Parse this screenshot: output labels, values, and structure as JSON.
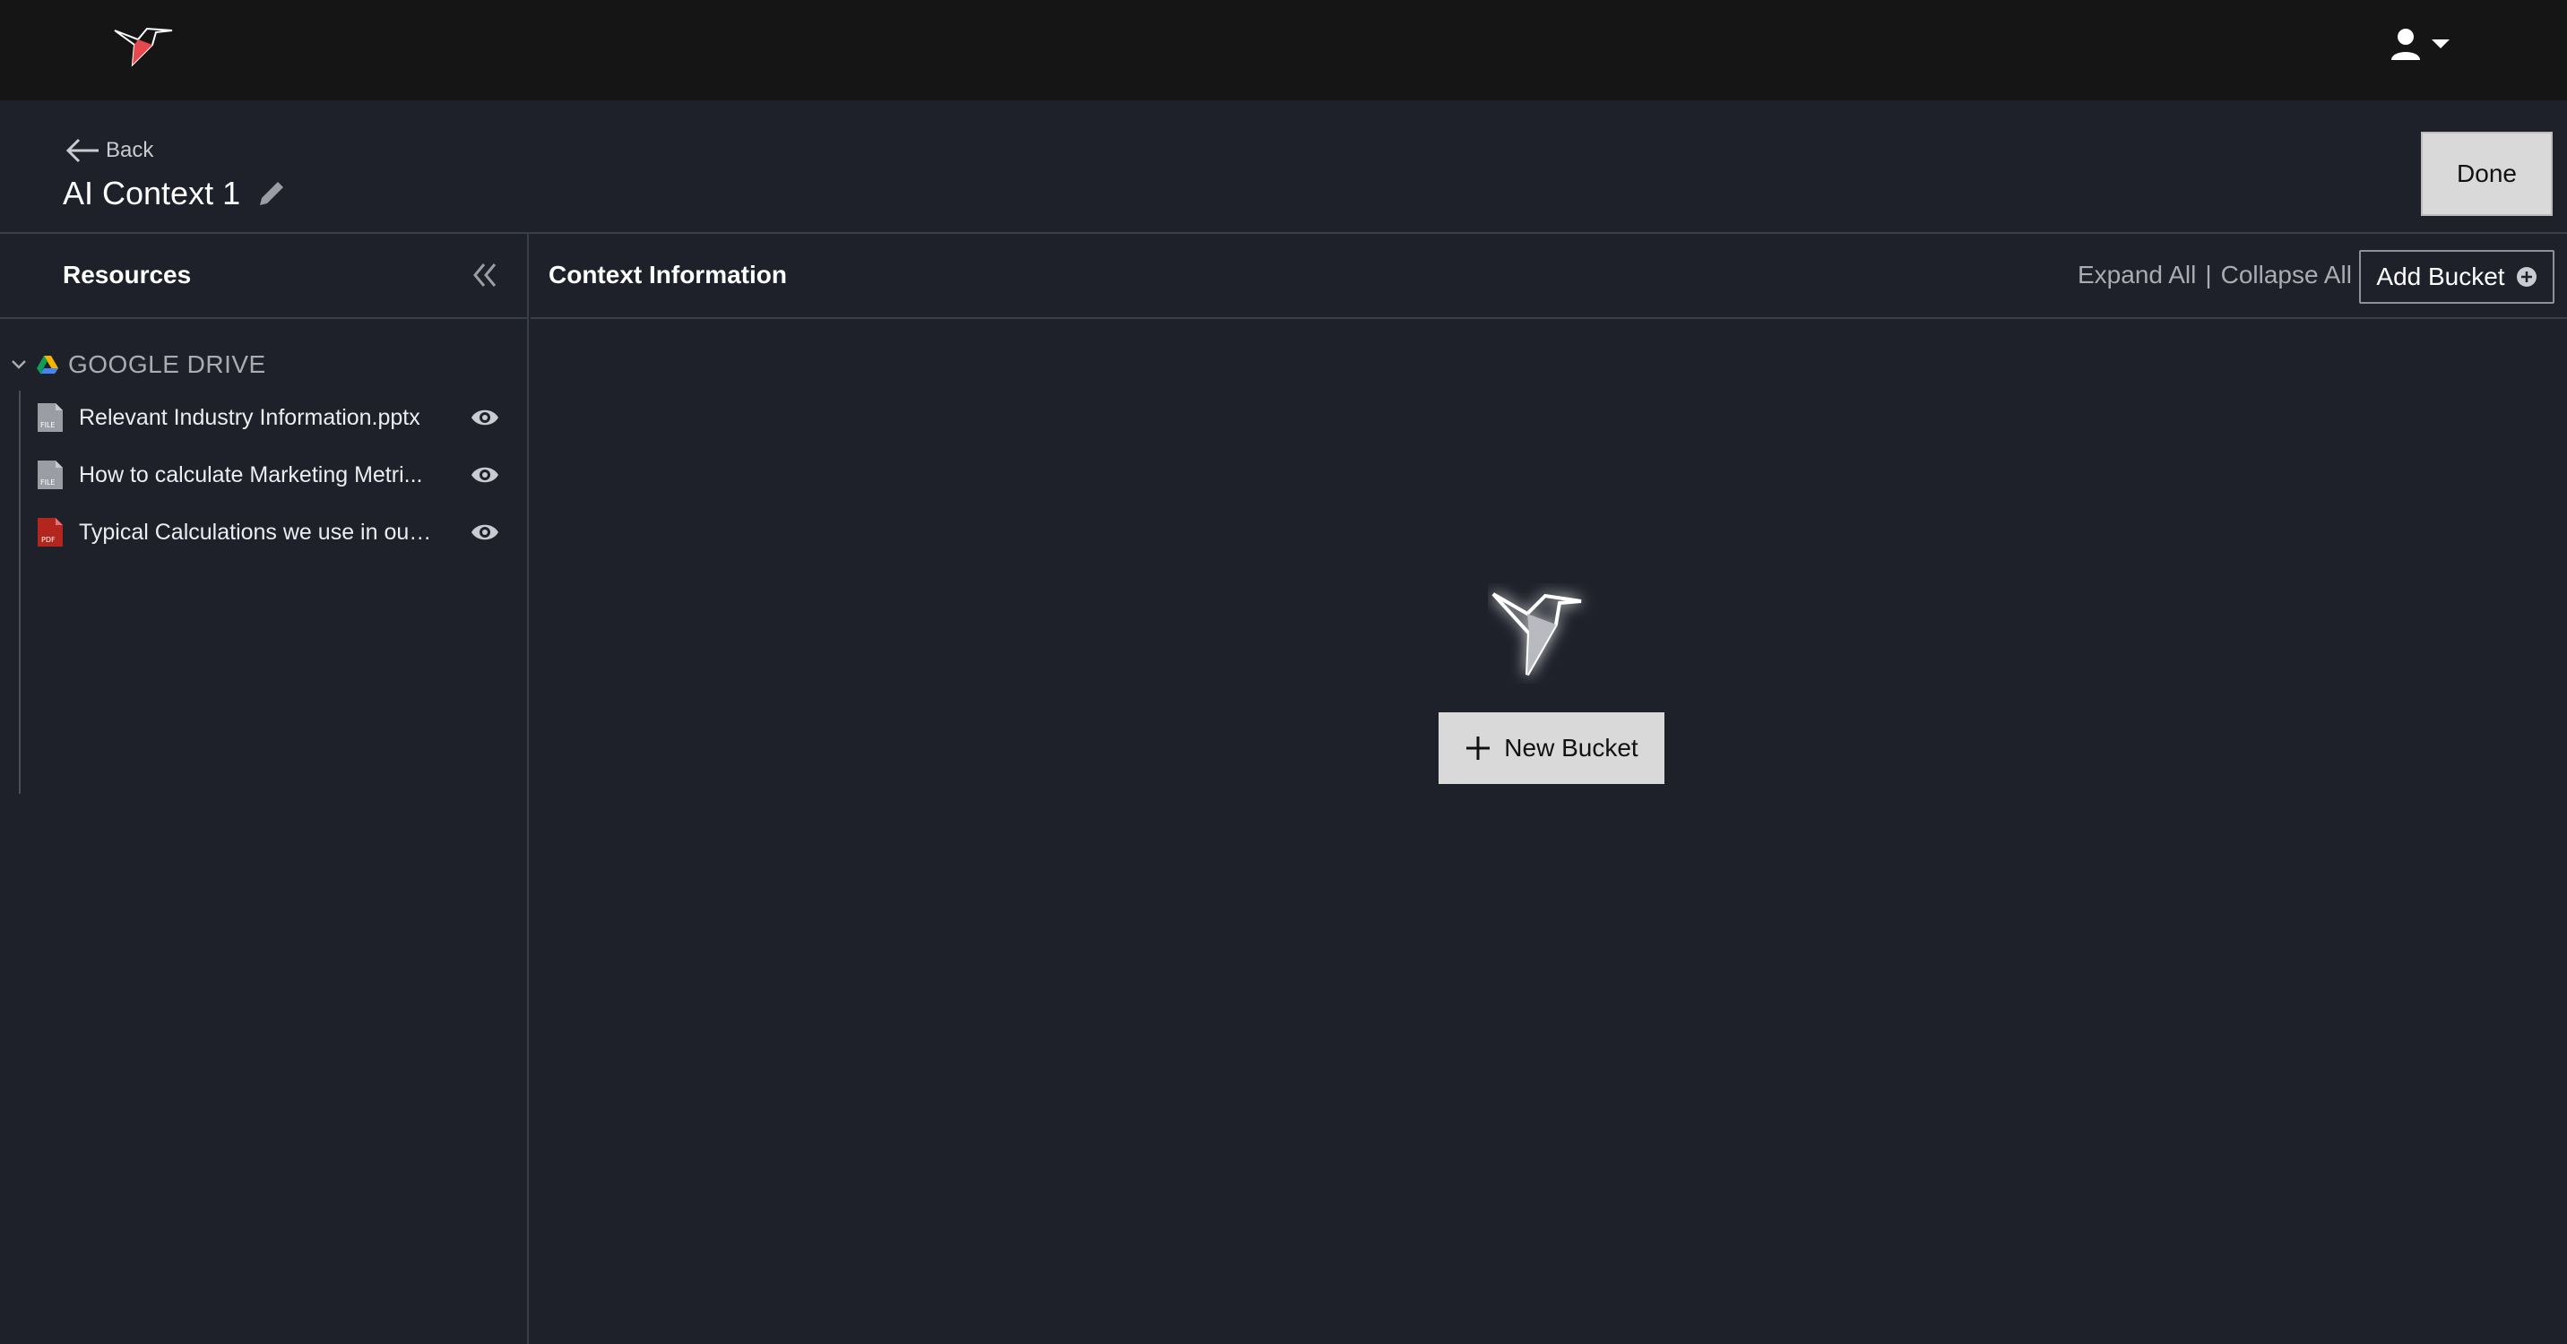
{
  "header": {
    "back_label": "Back",
    "page_title": "AI Context 1",
    "done_label": "Done"
  },
  "sidebar": {
    "title": "Resources",
    "group_label": "GOOGLE DRIVE",
    "files": [
      {
        "name": "Relevant Industry Information.pptx",
        "icon": "file-icon",
        "icon_text": "FILE"
      },
      {
        "name": "How to calculate Marketing Metri...",
        "icon": "file-icon",
        "icon_text": "FILE"
      },
      {
        "name": "Typical Calculations we use in our ...",
        "icon": "pdf-icon",
        "icon_text": "PDF"
      }
    ]
  },
  "main": {
    "title": "Context Information",
    "expand_all": "Expand All",
    "separator": "|",
    "collapse_all": "Collapse All",
    "add_bucket": "Add Bucket",
    "new_bucket": "New Bucket"
  },
  "colors": {
    "background": "#1e212a",
    "topbar": "#151516",
    "accent_red": "#e5484d",
    "button_light": "#d9d9d9"
  }
}
